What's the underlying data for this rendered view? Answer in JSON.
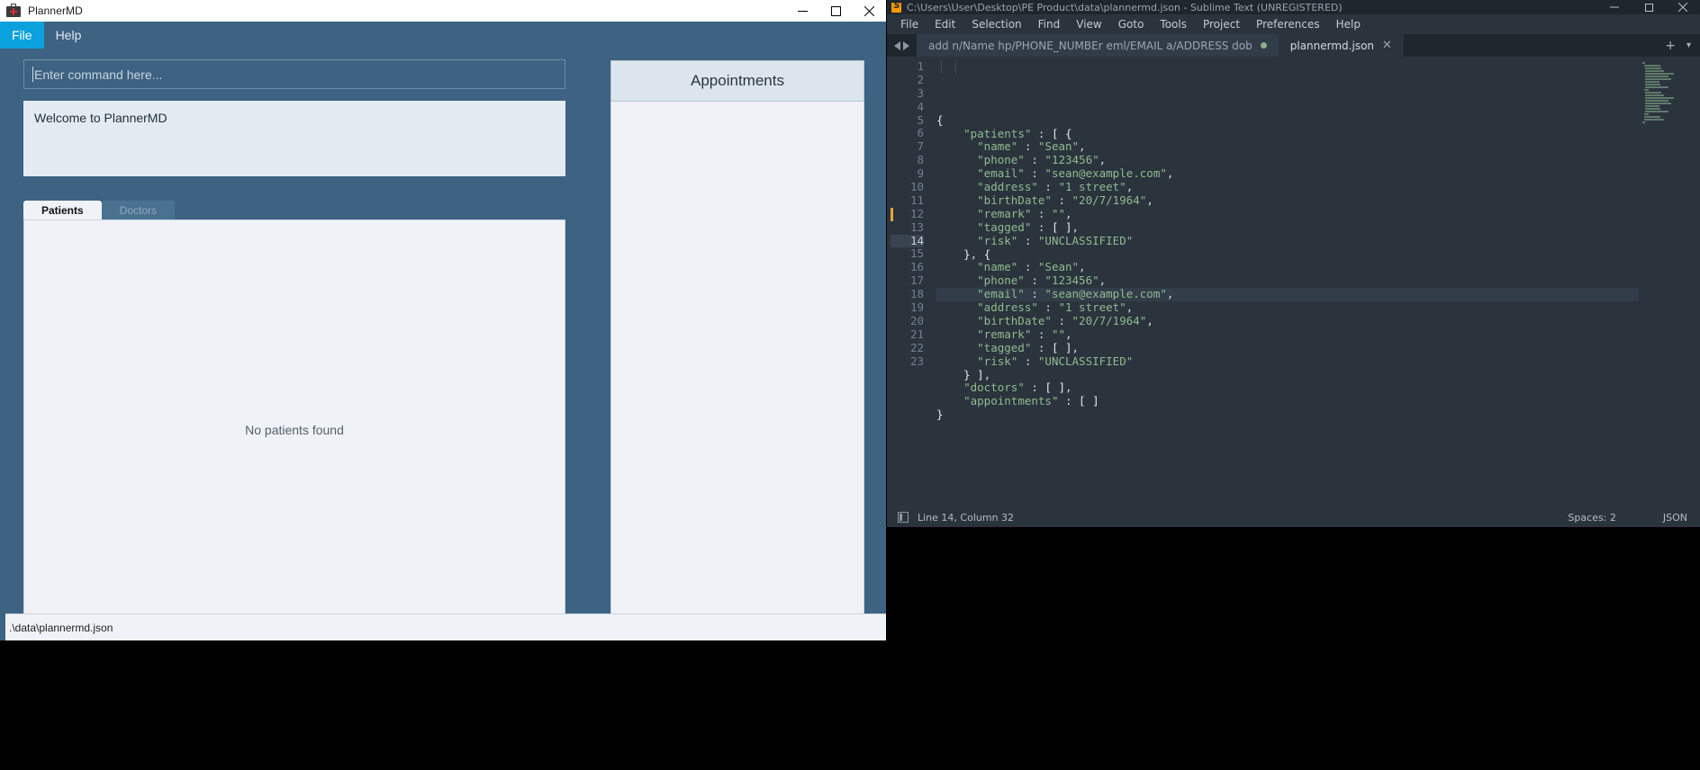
{
  "plannermd": {
    "title": "PlannerMD",
    "title_icon": "medical-bag-icon",
    "window_buttons": {
      "minimize": "minimize-icon",
      "maximize": "maximize-icon",
      "close": "close-icon"
    },
    "menus": [
      {
        "label": "File",
        "active": true
      },
      {
        "label": "Help",
        "active": false
      }
    ],
    "command_input": {
      "value": "",
      "placeholder": "Enter command here..."
    },
    "result_box": {
      "text": "Welcome to PlannerMD"
    },
    "tabs": [
      {
        "label": "Patients",
        "active": true
      },
      {
        "label": "Doctors",
        "active": false
      }
    ],
    "list_empty_message": "No patients found",
    "appointments": {
      "header": "Appointments",
      "items": []
    },
    "status_bar": {
      "text": ".\\data\\plannermd.json"
    },
    "colors": {
      "chrome": "#3d6282",
      "accent": "#0aa1dd",
      "panel": "#eff3f7",
      "panel_header": "#dce5ed"
    }
  },
  "sublime": {
    "title": "C:\\Users\\User\\Desktop\\PE Product\\data\\plannermd.json - Sublime Text (UNREGISTERED)",
    "logo_icon": "sublime-logo-icon",
    "window_buttons": {
      "minimize": "minimize-icon",
      "maximize": "maximize-icon",
      "close": "close-icon"
    },
    "menus": [
      {
        "label": "File",
        "mnemonic": "F"
      },
      {
        "label": "Edit",
        "mnemonic": "E"
      },
      {
        "label": "Selection",
        "mnemonic": "S"
      },
      {
        "label": "Find",
        "mnemonic": "n"
      },
      {
        "label": "View",
        "mnemonic": "V"
      },
      {
        "label": "Goto",
        "mnemonic": "G"
      },
      {
        "label": "Tools",
        "mnemonic": "T"
      },
      {
        "label": "Project",
        "mnemonic": "P"
      },
      {
        "label": "Preferences",
        "mnemonic": "n"
      },
      {
        "label": "Help",
        "mnemonic": "H"
      }
    ],
    "tabs": [
      {
        "label": "add n/Name hp/PHONE_NUMBEr eml/EMAIL a/ADDRESS dob",
        "active": false,
        "dirty": true
      },
      {
        "label": "plannermd.json",
        "active": true,
        "dirty": false,
        "close_icon": "close-icon"
      }
    ],
    "tabbar_right": [
      {
        "icon": "new-tab-icon",
        "label": "+"
      },
      {
        "icon": "chevron-down-icon",
        "label": "▾"
      }
    ],
    "editor": {
      "active_line": 14,
      "bookmark_line": 12,
      "lines": [
        {
          "n": 1,
          "text": "{"
        },
        {
          "n": 2,
          "text": "    \"patients\" : [ {"
        },
        {
          "n": 3,
          "text": "      \"name\" : \"Sean\","
        },
        {
          "n": 4,
          "text": "      \"phone\" : \"123456\","
        },
        {
          "n": 5,
          "text": "      \"email\" : \"sean@example.com\","
        },
        {
          "n": 6,
          "text": "      \"address\" : \"1 street\","
        },
        {
          "n": 7,
          "text": "      \"birthDate\" : \"20/7/1964\","
        },
        {
          "n": 8,
          "text": "      \"remark\" : \"\","
        },
        {
          "n": 9,
          "text": "      \"tagged\" : [ ],"
        },
        {
          "n": 10,
          "text": "      \"risk\" : \"UNCLASSIFIED\""
        },
        {
          "n": 11,
          "text": "    }, {"
        },
        {
          "n": 12,
          "text": "      \"name\" : \"Sean\","
        },
        {
          "n": 13,
          "text": "      \"phone\" : \"123456\","
        },
        {
          "n": 14,
          "text": "      \"email\" : \"sean@example.com\","
        },
        {
          "n": 15,
          "text": "      \"address\" : \"1 street\","
        },
        {
          "n": 16,
          "text": "      \"birthDate\" : \"20/7/1964\","
        },
        {
          "n": 17,
          "text": "      \"remark\" : \"\","
        },
        {
          "n": 18,
          "text": "      \"tagged\" : [ ],"
        },
        {
          "n": 19,
          "text": "      \"risk\" : \"UNCLASSIFIED\""
        },
        {
          "n": 20,
          "text": "    } ],"
        },
        {
          "n": 21,
          "text": "    \"doctors\" : [ ],"
        },
        {
          "n": 22,
          "text": "    \"appointments\" : [ ]"
        },
        {
          "n": 23,
          "text": "}"
        }
      ]
    },
    "status_bar": {
      "cursor": "Line 14, Column 32",
      "indent": "Spaces: 2",
      "syntax": "JSON",
      "left_icon": "sidebar-toggle-icon"
    },
    "colors": {
      "bg": "#2b333d",
      "chrome": "#1f262e",
      "string": "#8fbc8f",
      "text": "#d3dae1"
    }
  }
}
